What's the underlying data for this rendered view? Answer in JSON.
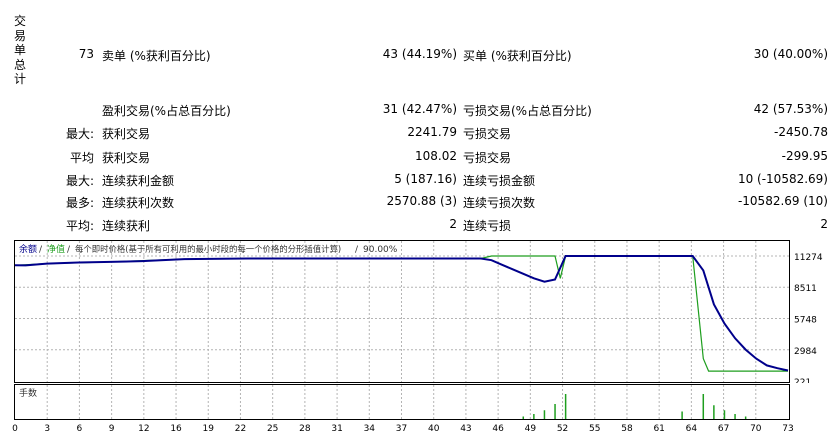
{
  "side_label": "交易单总计",
  "header": {
    "total": "73",
    "sell_label": "卖单 (%获利百分比)",
    "sell_value": "43 (44.19%)",
    "buy_label": "买单 (%获利百分比)",
    "buy_value": "30 (40.00%)"
  },
  "rows": [
    {
      "prefix": "",
      "label1": "盈利交易(%占总百分比)",
      "value1": "31 (42.47%)",
      "label2": "亏损交易(%占总百分比)",
      "value2": "42 (57.53%)"
    },
    {
      "prefix": "最大:",
      "label1": "获利交易",
      "value1": "2241.79",
      "label2": "亏损交易",
      "value2": "-2450.78"
    },
    {
      "prefix": "平均",
      "label1": "获利交易",
      "value1": "108.02",
      "label2": "亏损交易",
      "value2": "-299.95"
    },
    {
      "prefix": "最大:",
      "label1": "连续获利金额",
      "value1": "5 (187.16)",
      "label2": "连续亏损金额",
      "value2": "10 (-10582.69)"
    },
    {
      "prefix": "最多:",
      "label1": "连续获利次数",
      "value1": "2570.88 (3)",
      "label2": "连续亏损次数",
      "value2": "-10582.69 (10)"
    },
    {
      "prefix": "平均:",
      "label1": "连续获利",
      "value1": "2",
      "label2": "连续亏损",
      "value2": "2"
    }
  ],
  "chart_header": {
    "balance": "余额",
    "sep1": "/",
    "equity": "净值",
    "sep2": "/",
    "model": "每个即时价格(基于所有可利用的最小时段的每一个价格的分形插值计算)",
    "sep3": "/",
    "quality": "90.00%"
  },
  "volume_label": "手数",
  "colors": {
    "balance": "#00008b",
    "equity": "#1e9e1e",
    "grid": "#b4b4b4",
    "volume": "#1e9e1e"
  },
  "chart_data": {
    "type": "line",
    "x_ticks": [
      "0",
      "3",
      "6",
      "9",
      "12",
      "16",
      "19",
      "22",
      "25",
      "28",
      "31",
      "34",
      "37",
      "40",
      "43",
      "46",
      "49",
      "52",
      "55",
      "58",
      "61",
      "64",
      "67",
      "70",
      "73"
    ],
    "y_ticks": [
      "11274",
      "8511",
      "5748",
      "2984",
      "221"
    ],
    "series": [
      {
        "name": "余额",
        "points": [
          [
            0,
            10450
          ],
          [
            1,
            10440
          ],
          [
            2,
            10520
          ],
          [
            3,
            10600
          ],
          [
            6,
            10700
          ],
          [
            9,
            10750
          ],
          [
            12,
            10820
          ],
          [
            16,
            11000
          ],
          [
            22,
            11050
          ],
          [
            30,
            11050
          ],
          [
            43,
            11050
          ],
          [
            44,
            11050
          ],
          [
            45,
            10900
          ],
          [
            46,
            10500
          ],
          [
            47,
            10100
          ],
          [
            48,
            9700
          ],
          [
            49,
            9300
          ],
          [
            50,
            9000
          ],
          [
            51,
            9200
          ],
          [
            52,
            11274
          ],
          [
            53,
            11274
          ],
          [
            60,
            11274
          ],
          [
            64,
            11274
          ],
          [
            65,
            10000
          ],
          [
            66,
            7000
          ],
          [
            67,
            5300
          ],
          [
            68,
            4000
          ],
          [
            69,
            3000
          ],
          [
            70,
            2200
          ],
          [
            71,
            1600
          ],
          [
            72,
            1350
          ],
          [
            73,
            1150
          ]
        ]
      },
      {
        "name": "净值",
        "points": [
          [
            0,
            10450
          ],
          [
            3,
            10600
          ],
          [
            9,
            10750
          ],
          [
            16,
            11000
          ],
          [
            22,
            11050
          ],
          [
            43,
            11050
          ],
          [
            44,
            11050
          ],
          [
            45,
            11274
          ],
          [
            51,
            11274
          ],
          [
            51.5,
            9300
          ],
          [
            52,
            11274
          ],
          [
            64,
            11274
          ],
          [
            65,
            2200
          ],
          [
            65.5,
            1100
          ],
          [
            73,
            1100
          ]
        ]
      }
    ],
    "volume": [
      [
        48,
        0.1
      ],
      [
        49,
        0.2
      ],
      [
        50,
        0.35
      ],
      [
        51,
        0.6
      ],
      [
        52,
        1.0
      ],
      [
        63,
        0.3
      ],
      [
        65,
        1.0
      ],
      [
        66,
        0.55
      ],
      [
        67,
        0.35
      ],
      [
        68,
        0.2
      ],
      [
        69,
        0.1
      ]
    ]
  }
}
